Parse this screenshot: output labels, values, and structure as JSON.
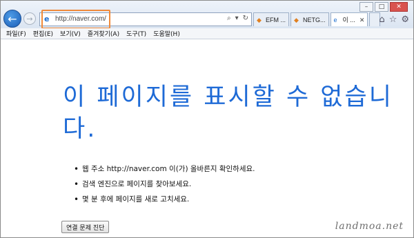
{
  "address_bar": {
    "url": "http://naver.com/"
  },
  "tabs": [
    {
      "label": "EFM ..."
    },
    {
      "label": "NETG..."
    },
    {
      "label": "이 ..."
    }
  ],
  "menu": [
    "파일(F)",
    "편집(E)",
    "보기(V)",
    "즐겨찾기(A)",
    "도구(T)",
    "도움말(H)"
  ],
  "error": {
    "headline": "이 페이지를 표시할 수 없습니다.",
    "tips": [
      "웹 주소 http://naver.com 이(가) 올바른지 확인하세요.",
      "검색 엔진으로 페이지를 찾아보세요.",
      "몇 분 후에 페이지를 새로 고치세요."
    ],
    "diagnose_button": "연결 문제 진단"
  },
  "watermark": "landmoa.net",
  "colors": {
    "headline": "#1e6ad6",
    "highlight": "#f08a3a"
  },
  "icons": {
    "back": "back-arrow-icon",
    "forward": "forward-arrow-icon",
    "home": "home-icon",
    "favorites": "star-icon",
    "tools": "gear-icon"
  }
}
